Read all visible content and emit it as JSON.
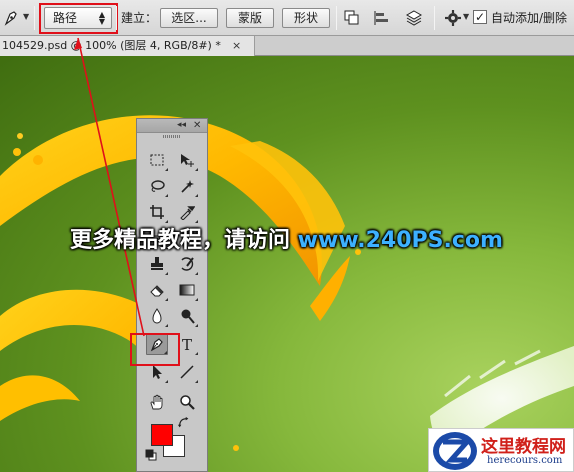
{
  "options_bar": {
    "tool_icon": "pen-icon",
    "mode_select_value": "路径",
    "make_label": "建立：",
    "selection_button": "选区...",
    "mask_button": "蒙版",
    "shape_button": "形状",
    "path_ops_icon": "path-operations-icon",
    "path_align_icon": "path-alignment-icon",
    "path_arrange_icon": "path-arrangement-icon",
    "settings_icon": "gear-icon",
    "auto_add_delete_label": "自动添加/删除",
    "auto_add_delete_checked": true
  },
  "document_tab": {
    "title": "104529.psd @ 100% (图层 4, RGB/8#) *",
    "close_label": "×"
  },
  "toolbox": {
    "collapse_label": "◂◂",
    "close_label": "✕",
    "tools": [
      "rectangular-marquee-icon",
      "move-icon",
      "lasso-icon",
      "magic-wand-icon",
      "crop-icon",
      "eyedropper-icon",
      "clone-stamp-icon",
      "history-brush-icon",
      "eraser-icon",
      "gradient-icon",
      "blur-icon",
      "dodge-icon",
      "pen-icon",
      "type-icon",
      "path-selection-icon",
      "line-icon",
      "hand-icon",
      "zoom-icon"
    ],
    "foreground_color": "#ff0000",
    "background_color": "#ffffff"
  },
  "watermark": {
    "text": "更多精品教程，请访问 ",
    "url": "www.240PS.com"
  },
  "logo": {
    "name": "这里教程网",
    "url": "herecours.com"
  },
  "colors": {
    "highlight": "#e0101a",
    "canvas_green": "#5e911f"
  }
}
